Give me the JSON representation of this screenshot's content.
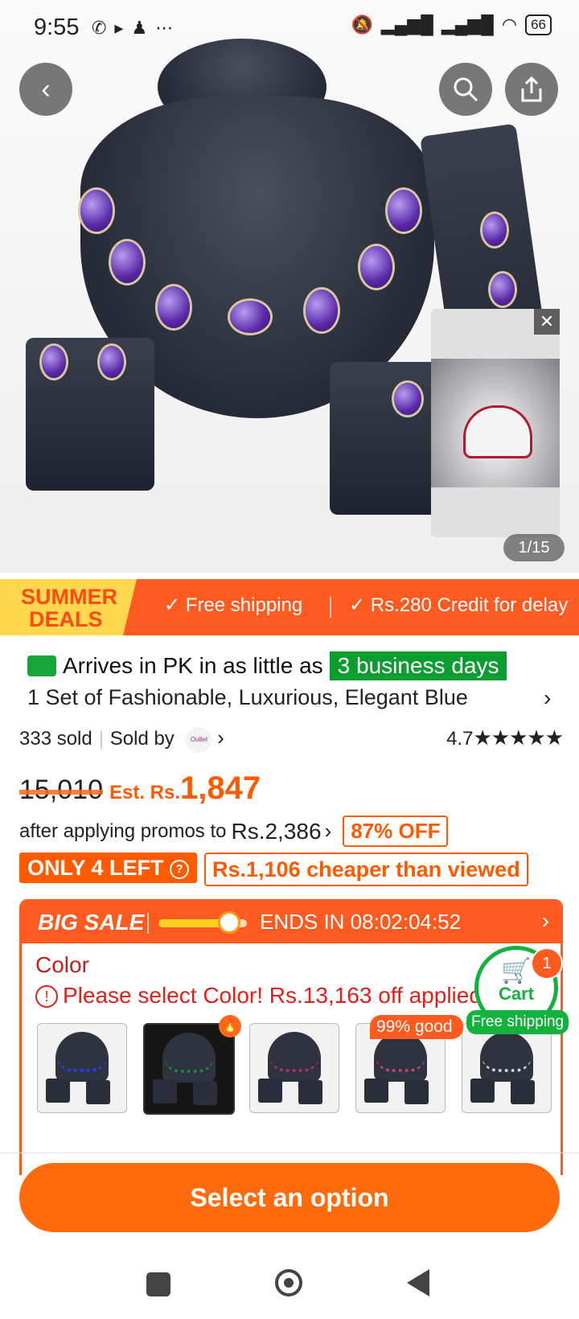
{
  "status_bar": {
    "time": "9:55",
    "left_icons": [
      "whatsapp-icon",
      "play-icon",
      "snapchat-icon",
      "more-icon"
    ],
    "battery": "66"
  },
  "hero": {
    "counter": "1/15"
  },
  "banner": {
    "summer": "SUMMER",
    "deals": "DEALS",
    "item1": "✓ Free shipping",
    "item2": "✓ Rs.280 Credit for delay"
  },
  "arrival": {
    "text": "Arrives in PK in as little as",
    "highlight": "3 business days"
  },
  "product": {
    "title": "1 Set of Fashionable, Luxurious, Elegant Blue",
    "sold": "333 sold",
    "sold_by": "Sold by",
    "store_logo_text": "Outlet",
    "rating": "4.7",
    "stars": "★★★★★"
  },
  "price": {
    "old": "15,010",
    "est_label": "Est. Rs.",
    "current": "1,847",
    "promo_text": "after applying promos to",
    "promo_price": "Rs.2,386",
    "discount": "87% OFF",
    "only_left": "ONLY 4 LEFT",
    "cheaper": "Rs.1,106 cheaper than viewed"
  },
  "big_sale": {
    "label": "BIG SALE",
    "ends": "ENDS IN 08:02:04:52",
    "progress": 0.75
  },
  "options": {
    "color_label": "Color",
    "warning": "Please select Color! Rs.13,163 off applied",
    "badge": "99% good",
    "swatch_colors": [
      "#2a3aff",
      "#1d8a3a",
      "#b03060",
      "#c8406a",
      "#d0d0d0"
    ]
  },
  "cart": {
    "label": "Cart",
    "count": "1",
    "free_shipping": "Free shipping"
  },
  "cta": {
    "label": "Select an option"
  }
}
